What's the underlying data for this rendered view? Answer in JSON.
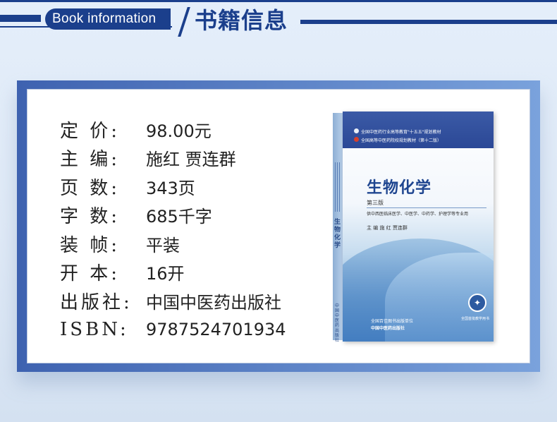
{
  "header": {
    "label_en": "Book information",
    "label_cn": "书籍信息"
  },
  "info_rows": [
    {
      "label": "定 价:",
      "value": "98.00元"
    },
    {
      "label": "主 编:",
      "value": "施红 贾连群"
    },
    {
      "label": "页 数:",
      "value": "343页"
    },
    {
      "label": "字 数:",
      "value": "685千字"
    },
    {
      "label": "装 帧:",
      "value": "平装"
    },
    {
      "label": "开 本:",
      "value": "16开"
    },
    {
      "label": "出版社:",
      "value": "中国中医药出版社"
    },
    {
      "label": "ISBN:",
      "value": "9787524701934"
    }
  ],
  "book_cover": {
    "series_line_1": "全国中医药行业高等教育\"十五五\"规划教材",
    "series_line_2": "全国高等中医药院校规划教材（第十二版）",
    "title": "生物化学",
    "edition": "第三版",
    "usage": "供中西医临床医学、中医学、中药学、护理学等专业用",
    "authors": "主 编  施 红  贾连群",
    "publisher_line_1": "全国百佳图书出版单位",
    "publisher_line_2": "中国中医药出版社",
    "spine_title": "生物化学",
    "spine_publisher": "中国中医药出版社",
    "seal_caption": "全国首批教学用书",
    "colors": {
      "brand_blue": "#1b3f8c",
      "cover_title_blue": "#1f4690"
    }
  },
  "icons": {
    "seal": "seal-emblem-icon",
    "badge_1": "series-badge-icon",
    "badge_2": "series-badge-icon"
  }
}
